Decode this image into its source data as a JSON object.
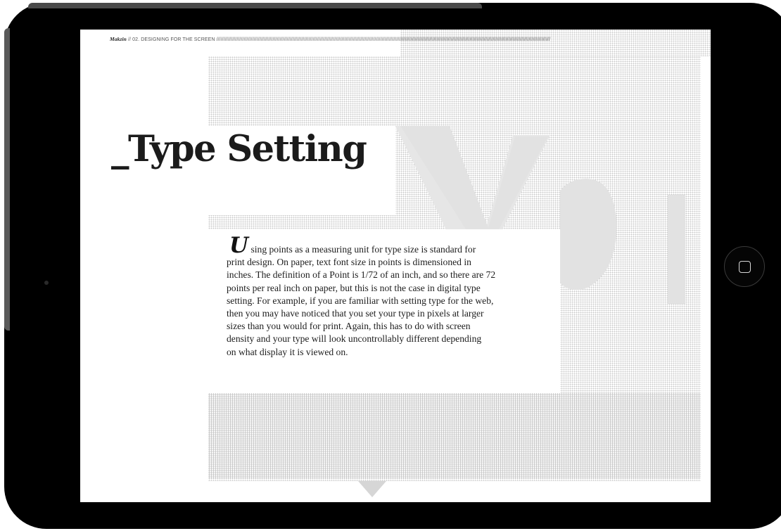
{
  "app": {
    "brand": "Makzin",
    "breadcrumb": "// 02. DESIGNING FOR THE SCREEN ////////////////////////////////////////////////////////////////////////////////////////////////////////////////////////////////////////////////////////////////////////////////////////////////////////////////////////////////////////"
  },
  "article": {
    "title": "_Type Setting",
    "drop_cap": "U",
    "lines": [
      "sing points as a measuring unit for type size is standard for",
      "print design. On paper, text font size in points is dimensioned in",
      "inches. The definition of a Point is 1/72 of an inch, and so there are 72",
      "points per real inch on paper, but this is not the case in digital type",
      "setting. For example, if you are familiar with setting type for the web,",
      "then you may have noticed that you set your type in pixels at larger",
      "sizes than you would for print. Again, this has to do with screen",
      "density and your type will look uncontrollably different depending",
      "on what display it is viewed on."
    ]
  },
  "decoration": {
    "background_letters": "Vp",
    "dot_color": "#c9c9c9"
  },
  "device": {
    "home_button_icon": "home-button-square-icon"
  }
}
